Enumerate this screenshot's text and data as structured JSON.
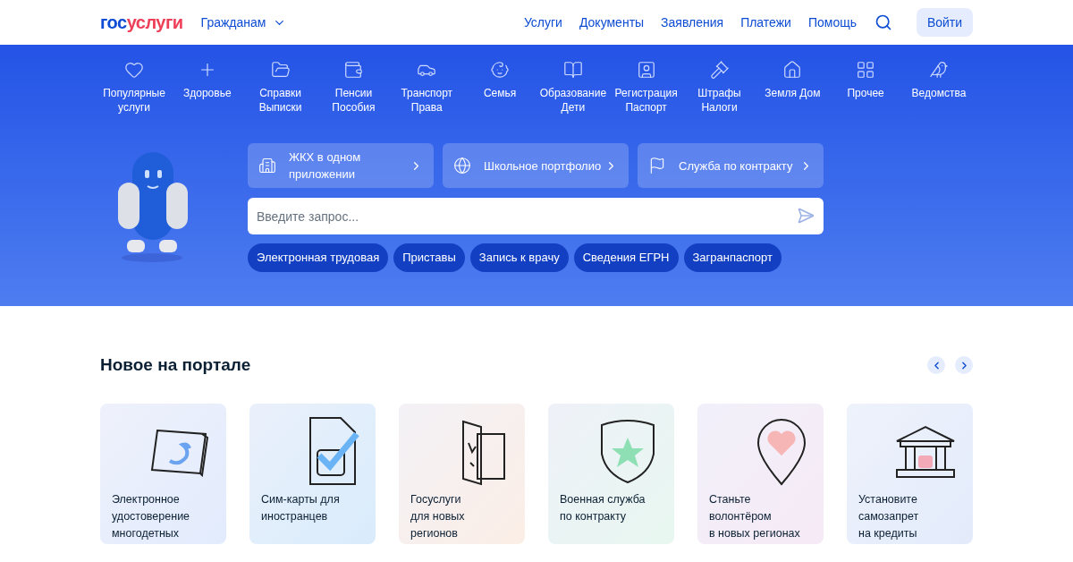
{
  "header": {
    "logo": {
      "first": "гос",
      "second": "услуги"
    },
    "audience": "Гражданам",
    "nav": [
      "Услуги",
      "Документы",
      "Заявления",
      "Платежи",
      "Помощь"
    ],
    "login": "Войти"
  },
  "categories": [
    {
      "kind": "heart",
      "lines": [
        "Популярные",
        "услуги"
      ]
    },
    {
      "kind": "plus",
      "lines": [
        "Здоровье"
      ]
    },
    {
      "kind": "folder",
      "lines": [
        "Справки",
        "Выписки"
      ]
    },
    {
      "kind": "wallet",
      "lines": [
        "Пенсии",
        "Пособия"
      ]
    },
    {
      "kind": "car",
      "lines": [
        "Транспорт",
        "Права"
      ]
    },
    {
      "kind": "stroller",
      "lines": [
        "Семья"
      ]
    },
    {
      "kind": "book",
      "lines": [
        "Образование",
        "Дети"
      ]
    },
    {
      "kind": "id",
      "lines": [
        "Регистрация",
        "Паспорт"
      ]
    },
    {
      "kind": "gavel",
      "lines": [
        "Штрафы",
        "Налоги"
      ]
    },
    {
      "kind": "house",
      "lines": [
        "Земля Дом"
      ]
    },
    {
      "kind": "grid",
      "lines": [
        "Прочее"
      ]
    },
    {
      "kind": "eagle",
      "lines": [
        "Ведомства"
      ]
    }
  ],
  "quick_links": [
    {
      "kind": "building",
      "lines": [
        "ЖКХ в одном",
        "приложении"
      ]
    },
    {
      "kind": "globe",
      "lines": [
        "Школьное портфолио"
      ]
    },
    {
      "kind": "flag",
      "lines": [
        "Служба по контракту"
      ]
    }
  ],
  "search": {
    "placeholder": "Введите запрос..."
  },
  "chips": [
    "Электронная трудовая",
    "Приставы",
    "Запись к врачу",
    "Сведения ЕГРН",
    "Загранпаспорт"
  ],
  "news": {
    "title": "Новое на портале",
    "cards": [
      {
        "kind": "document",
        "lines": [
          "Электронное",
          "удостоверение",
          "многодетных"
        ]
      },
      {
        "kind": "sim",
        "lines": [
          "Сим-карты для",
          "иностранцев"
        ]
      },
      {
        "kind": "door",
        "lines": [
          "Госуслуги",
          "для новых",
          "регионов"
        ]
      },
      {
        "kind": "shield",
        "lines": [
          "Военная служба",
          "по контракту"
        ]
      },
      {
        "kind": "pin",
        "lines": [
          "Станьте",
          "волонтёром",
          "в новых регионах"
        ]
      },
      {
        "kind": "bank",
        "lines": [
          "Установите",
          "самозапрет",
          "на кредиты"
        ]
      }
    ]
  }
}
